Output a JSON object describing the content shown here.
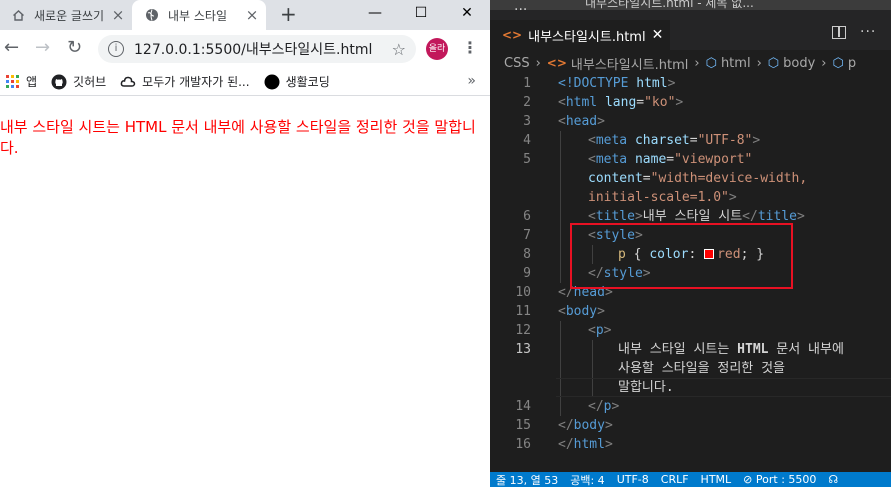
{
  "browser": {
    "tabs": [
      {
        "label": "새로운 글쓰기",
        "icon": "home-icon"
      },
      {
        "label": "내부 스타일",
        "icon": "globe-icon"
      }
    ],
    "url": "127.0.0.1:5500/내부스타일시트.html",
    "profile_label": "올라",
    "bookmarks": [
      {
        "label": "앱",
        "icon": "apps-grid-icon"
      },
      {
        "label": "깃허브",
        "icon": "github-icon"
      },
      {
        "label": "모두가 개발자가 된...",
        "icon": "cloud-icon"
      },
      {
        "label": "생활코딩",
        "icon": "black-circle-icon"
      }
    ],
    "page_text": "내부 스타일 시트는 HTML 문서 내부에 사용할 스타일을 정리한 것을 말합니다.",
    "text_color": "#ff0000"
  },
  "editor": {
    "window_title": "내부스타일시트.html - 제목 없...",
    "tab_label": "내부스타일시트.html",
    "breadcrumb": [
      "CSS",
      "내부스타일시트.html",
      "html",
      "body",
      "p"
    ],
    "line_numbers": [
      "1",
      "2",
      "3",
      "4",
      "5",
      "",
      "",
      "6",
      "7",
      "8",
      "9",
      "10",
      "11",
      "12",
      "13",
      "",
      "",
      "14",
      "15",
      "16"
    ],
    "code": {
      "l1": [
        "<!DOCTYPE ",
        "html",
        ">"
      ],
      "l2": [
        "<",
        "html",
        " ",
        "lang",
        "=",
        "\"ko\"",
        ">"
      ],
      "l3": [
        "<",
        "head",
        ">"
      ],
      "l4": [
        "<",
        "meta",
        " ",
        "charset",
        "=",
        "\"UTF-8\"",
        ">"
      ],
      "l5a": [
        "<",
        "meta",
        " ",
        "name",
        "=",
        "\"viewport\""
      ],
      "l5b": [
        "content",
        "=",
        "\"width=device-width,"
      ],
      "l5c": [
        "initial-scale=1.0\"",
        ">"
      ],
      "l6": [
        "<",
        "title",
        ">",
        "내부 스타일 시트",
        "</",
        "title",
        ">"
      ],
      "l7": [
        "<",
        "style",
        ">"
      ],
      "l8": [
        "p",
        " { ",
        "color",
        ": ",
        "red",
        "; }"
      ],
      "l9": [
        "</",
        "style",
        ">"
      ],
      "l10": [
        "</",
        "head",
        ">"
      ],
      "l11": [
        "<",
        "body",
        ">"
      ],
      "l12": [
        "<",
        "p",
        ">"
      ],
      "l13a": [
        "내부 스타일 시트는 ",
        "HTML",
        " 문서 내부에"
      ],
      "l13b": "사용할 스타일을 정리한 것을",
      "l13c": "말합니다.",
      "l14": [
        "</",
        "p",
        ">"
      ],
      "l15": [
        "</",
        "body",
        ">"
      ],
      "l16": [
        "</",
        "html",
        ">"
      ]
    },
    "status": {
      "position": "줄 13, 열 53",
      "spaces": "공백: 4",
      "encoding": "UTF-8",
      "eol": "CRLF",
      "language": "HTML",
      "port": "Port : 5500"
    },
    "colors": {
      "highlight_box": "#e81123",
      "swatch": "#ff0000",
      "status_bar": "#007acc"
    }
  }
}
